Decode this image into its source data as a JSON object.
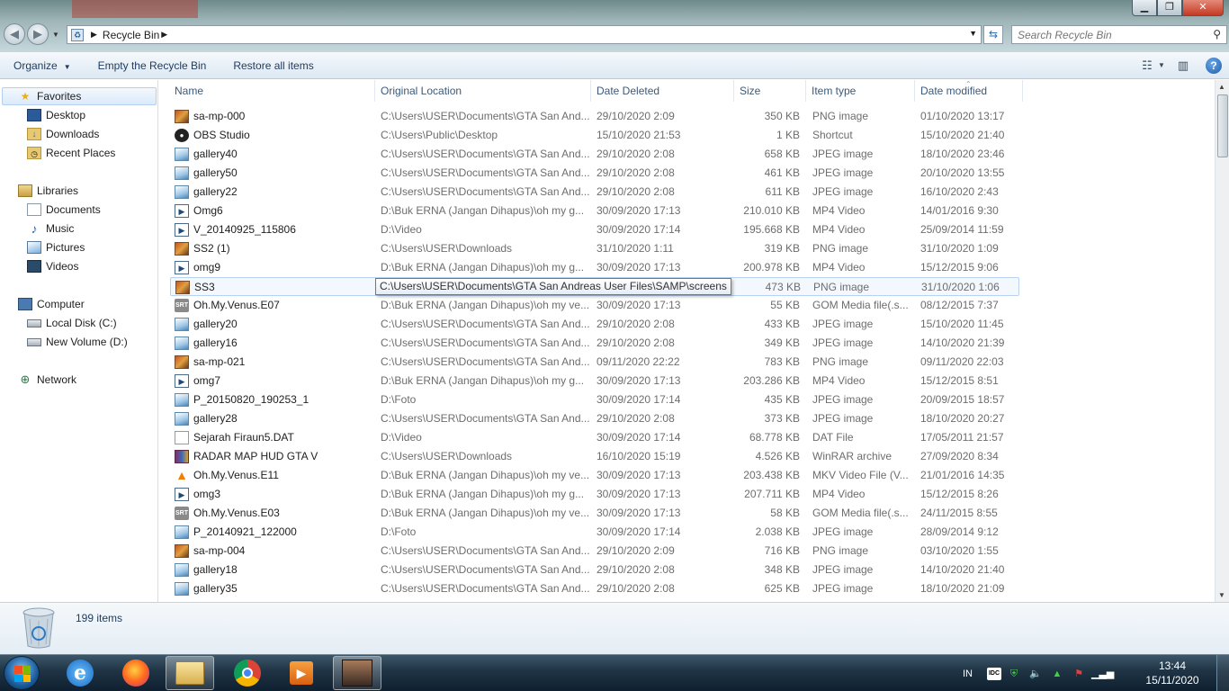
{
  "window": {
    "minimize": "▁",
    "maximize": "❐",
    "close": "✕"
  },
  "address": {
    "crumb": "Recycle Bin",
    "search_placeholder": "Search Recycle Bin"
  },
  "toolbar": {
    "organize": "Organize",
    "empty": "Empty the Recycle Bin",
    "restore": "Restore all items"
  },
  "nav": {
    "favorites": "Favorites",
    "desktop": "Desktop",
    "downloads": "Downloads",
    "recent": "Recent Places",
    "libraries": "Libraries",
    "documents": "Documents",
    "music": "Music",
    "pictures": "Pictures",
    "videos": "Videos",
    "computer": "Computer",
    "local_disk": "Local Disk (C:)",
    "new_volume": "New Volume (D:)",
    "network": "Network"
  },
  "columns": {
    "name": "Name",
    "location": "Original Location",
    "deleted": "Date Deleted",
    "size": "Size",
    "type": "Item type",
    "modified": "Date modified"
  },
  "files": [
    {
      "name": "sa-mp-000",
      "loc": "C:\\Users\\USER\\Documents\\GTA San And...",
      "deleted": "29/10/2020 2:09",
      "size": "350 KB",
      "type": "PNG image",
      "modified": "01/10/2020 13:17",
      "icon": "png"
    },
    {
      "name": "OBS Studio",
      "loc": "C:\\Users\\Public\\Desktop",
      "deleted": "15/10/2020 21:53",
      "size": "1 KB",
      "type": "Shortcut",
      "modified": "15/10/2020 21:40",
      "icon": "obs"
    },
    {
      "name": "gallery40",
      "loc": "C:\\Users\\USER\\Documents\\GTA San And...",
      "deleted": "29/10/2020 2:08",
      "size": "658 KB",
      "type": "JPEG image",
      "modified": "18/10/2020 23:46",
      "icon": "jpg"
    },
    {
      "name": "gallery50",
      "loc": "C:\\Users\\USER\\Documents\\GTA San And...",
      "deleted": "29/10/2020 2:08",
      "size": "461 KB",
      "type": "JPEG image",
      "modified": "20/10/2020 13:55",
      "icon": "jpg"
    },
    {
      "name": "gallery22",
      "loc": "C:\\Users\\USER\\Documents\\GTA San And...",
      "deleted": "29/10/2020 2:08",
      "size": "611 KB",
      "type": "JPEG image",
      "modified": "16/10/2020 2:43",
      "icon": "jpg"
    },
    {
      "name": "Omg6",
      "loc": "D:\\Buk ERNA (Jangan Dihapus)\\oh my g...",
      "deleted": "30/09/2020 17:13",
      "size": "210.010 KB",
      "type": "MP4 Video",
      "modified": "14/01/2016 9:30",
      "icon": "mp4"
    },
    {
      "name": "V_20140925_115806",
      "loc": "D:\\Video",
      "deleted": "30/09/2020 17:14",
      "size": "195.668 KB",
      "type": "MP4 Video",
      "modified": "25/09/2014 11:59",
      "icon": "mp4"
    },
    {
      "name": "SS2 (1)",
      "loc": "C:\\Users\\USER\\Downloads",
      "deleted": "31/10/2020 1:11",
      "size": "319 KB",
      "type": "PNG image",
      "modified": "31/10/2020 1:09",
      "icon": "png"
    },
    {
      "name": "omg9",
      "loc": "D:\\Buk ERNA (Jangan Dihapus)\\oh my g...",
      "deleted": "30/09/2020 17:13",
      "size": "200.978 KB",
      "type": "MP4 Video",
      "modified": "15/12/2015 9:06",
      "icon": "mp4"
    },
    {
      "name": "SS3",
      "loc": "",
      "deleted": "",
      "size": "473 KB",
      "type": "PNG image",
      "modified": "31/10/2020 1:06",
      "icon": "png"
    },
    {
      "name": "Oh.My.Venus.E07",
      "loc": "D:\\Buk ERNA (Jangan Dihapus)\\oh my ve...",
      "deleted": "30/09/2020 17:13",
      "size": "55 KB",
      "type": "GOM Media file(.s...",
      "modified": "08/12/2015 7:37",
      "icon": "srt"
    },
    {
      "name": "gallery20",
      "loc": "C:\\Users\\USER\\Documents\\GTA San And...",
      "deleted": "29/10/2020 2:08",
      "size": "433 KB",
      "type": "JPEG image",
      "modified": "15/10/2020 11:45",
      "icon": "jpg"
    },
    {
      "name": "gallery16",
      "loc": "C:\\Users\\USER\\Documents\\GTA San And...",
      "deleted": "29/10/2020 2:08",
      "size": "349 KB",
      "type": "JPEG image",
      "modified": "14/10/2020 21:39",
      "icon": "jpg"
    },
    {
      "name": "sa-mp-021",
      "loc": "C:\\Users\\USER\\Documents\\GTA San And...",
      "deleted": "09/11/2020 22:22",
      "size": "783 KB",
      "type": "PNG image",
      "modified": "09/11/2020 22:03",
      "icon": "png"
    },
    {
      "name": "omg7",
      "loc": "D:\\Buk ERNA (Jangan Dihapus)\\oh my g...",
      "deleted": "30/09/2020 17:13",
      "size": "203.286 KB",
      "type": "MP4 Video",
      "modified": "15/12/2015 8:51",
      "icon": "mp4"
    },
    {
      "name": "P_20150820_190253_1",
      "loc": "D:\\Foto",
      "deleted": "30/09/2020 17:14",
      "size": "435 KB",
      "type": "JPEG image",
      "modified": "20/09/2015 18:57",
      "icon": "jpg"
    },
    {
      "name": "gallery28",
      "loc": "C:\\Users\\USER\\Documents\\GTA San And...",
      "deleted": "29/10/2020 2:08",
      "size": "373 KB",
      "type": "JPEG image",
      "modified": "18/10/2020 20:27",
      "icon": "jpg"
    },
    {
      "name": "Sejarah Firaun5.DAT",
      "loc": "D:\\Video",
      "deleted": "30/09/2020 17:14",
      "size": "68.778 KB",
      "type": "DAT File",
      "modified": "17/05/2011 21:57",
      "icon": "dat"
    },
    {
      "name": "RADAR MAP HUD GTA V",
      "loc": "C:\\Users\\USER\\Downloads",
      "deleted": "16/10/2020 15:19",
      "size": "4.526 KB",
      "type": "WinRAR archive",
      "modified": "27/09/2020 8:34",
      "icon": "rar"
    },
    {
      "name": "Oh.My.Venus.E11",
      "loc": "D:\\Buk ERNA (Jangan Dihapus)\\oh my ve...",
      "deleted": "30/09/2020 17:13",
      "size": "203.438 KB",
      "type": "MKV Video File (V...",
      "modified": "21/01/2016 14:35",
      "icon": "vlc"
    },
    {
      "name": "omg3",
      "loc": "D:\\Buk ERNA (Jangan Dihapus)\\oh my g...",
      "deleted": "30/09/2020 17:13",
      "size": "207.711 KB",
      "type": "MP4 Video",
      "modified": "15/12/2015 8:26",
      "icon": "mp4"
    },
    {
      "name": "Oh.My.Venus.E03",
      "loc": "D:\\Buk ERNA (Jangan Dihapus)\\oh my ve...",
      "deleted": "30/09/2020 17:13",
      "size": "58 KB",
      "type": "GOM Media file(.s...",
      "modified": "24/11/2015 8:55",
      "icon": "srt"
    },
    {
      "name": "P_20140921_122000",
      "loc": "D:\\Foto",
      "deleted": "30/09/2020 17:14",
      "size": "2.038 KB",
      "type": "JPEG image",
      "modified": "28/09/2014 9:12",
      "icon": "jpg"
    },
    {
      "name": "sa-mp-004",
      "loc": "C:\\Users\\USER\\Documents\\GTA San And...",
      "deleted": "29/10/2020 2:09",
      "size": "716 KB",
      "type": "PNG image",
      "modified": "03/10/2020 1:55",
      "icon": "png"
    },
    {
      "name": "gallery18",
      "loc": "C:\\Users\\USER\\Documents\\GTA San And...",
      "deleted": "29/10/2020 2:08",
      "size": "348 KB",
      "type": "JPEG image",
      "modified": "14/10/2020 21:40",
      "icon": "jpg"
    },
    {
      "name": "gallery35",
      "loc": "C:\\Users\\USER\\Documents\\GTA San And...",
      "deleted": "29/10/2020 2:08",
      "size": "625 KB",
      "type": "JPEG image",
      "modified": "18/10/2020 21:09",
      "icon": "jpg"
    }
  ],
  "tooltip": "C:\\Users\\USER\\Documents\\GTA San Andreas User Files\\SAMP\\screens",
  "status": {
    "count": "199 items"
  },
  "taskbar": {
    "lang": "IN",
    "time": "13:44",
    "date": "15/11/2020"
  },
  "colors": {
    "accent": "#1e3a5f",
    "muted_text": "#6d6d6d",
    "header_text": "#3a5a7c"
  }
}
